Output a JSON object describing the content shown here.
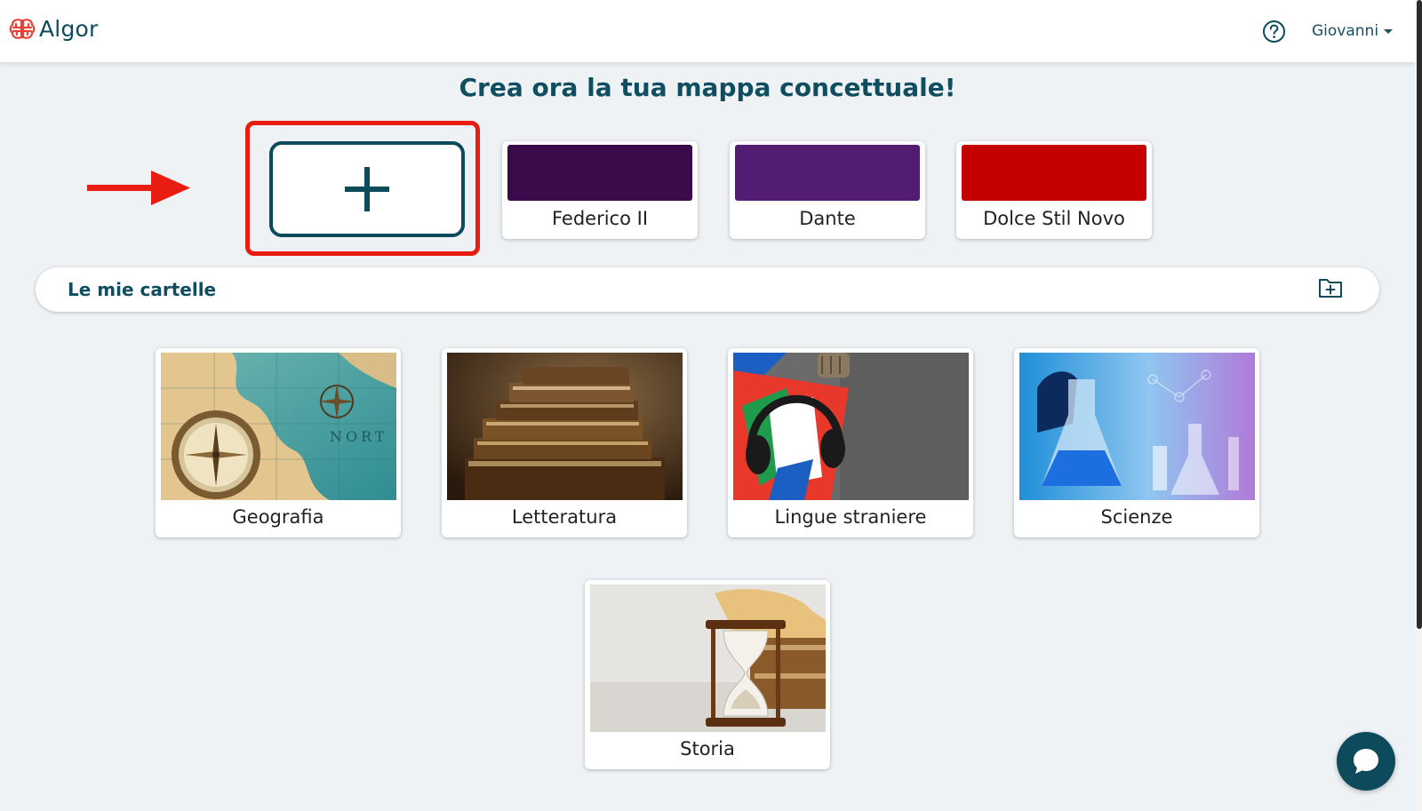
{
  "header": {
    "logo_text": "Algor",
    "logo_icon": "brain-icon",
    "help_icon": "question-circle-icon",
    "user_name": "Giovanni"
  },
  "main": {
    "title": "Crea ora la tua mappa concettuale!",
    "new_map_icon": "plus-icon",
    "recent_maps": [
      {
        "label": "Federico II",
        "color": "#3a0a4a"
      },
      {
        "label": "Dante",
        "color": "#531c73"
      },
      {
        "label": "Dolce Stil Novo",
        "color": "#c40000"
      }
    ]
  },
  "folders": {
    "title": "Le mie cartelle",
    "add_folder_icon": "folder-plus-icon",
    "items": [
      {
        "label": "Geografia",
        "image": "compass-map-image"
      },
      {
        "label": "Letteratura",
        "image": "old-books-image"
      },
      {
        "label": "Lingue straniere",
        "image": "headphones-flags-image"
      },
      {
        "label": "Scienze",
        "image": "lab-flask-image"
      },
      {
        "label": "Storia",
        "image": "hourglass-scrolls-image"
      }
    ]
  },
  "overlay": {
    "arrow_icon": "red-arrow-right-icon",
    "highlight_color": "#e81c10"
  },
  "chat": {
    "icon": "chat-bubble-icon"
  },
  "colors": {
    "accent": "#0d4a5c",
    "background": "#eef2f5"
  }
}
